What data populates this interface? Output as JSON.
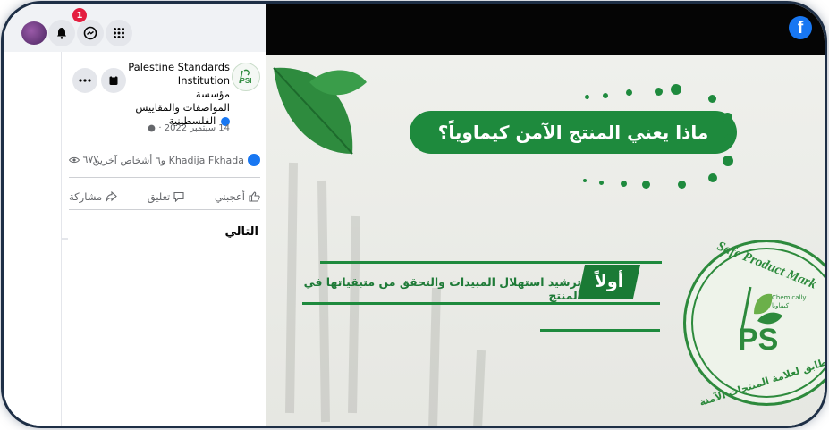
{
  "topbar": {
    "notification_count": "1"
  },
  "post": {
    "page_name_en": "Palestine Standards Institution",
    "page_name_ar_1": "مؤسسة",
    "page_name_ar_2": "المواصفات والمقاييس",
    "page_name_ar_3": "الفلسطينية",
    "date": "14 سبتمبر 2022 ·",
    "views": "٦٧٧",
    "reactors": "Khadija Fkhada و٦ أشخاص آخرين",
    "like_label": "أعجبني",
    "comment_label": "تعليق",
    "share_label": "مشاركة",
    "next_label": "التالي"
  },
  "video": {
    "heading": "ماذا يعني المنتج الآمن كيماوياً؟",
    "step_number": "أولاً",
    "step_text": "ترشيد استهلال المبيدات والتحقق من متبقياتها في المنتج",
    "seal_top": "Safe Product Mark",
    "seal_chem_en": "Chemically",
    "seal_chem_ar": "كيماويا",
    "seal_ps": "PS",
    "seal_bottom": "مطابق لعلامة المنتجات الآمنة"
  },
  "colors": {
    "brand_green": "#1e8a3d",
    "facebook_blue": "#1877f2",
    "badge_red": "#e41e3f"
  }
}
